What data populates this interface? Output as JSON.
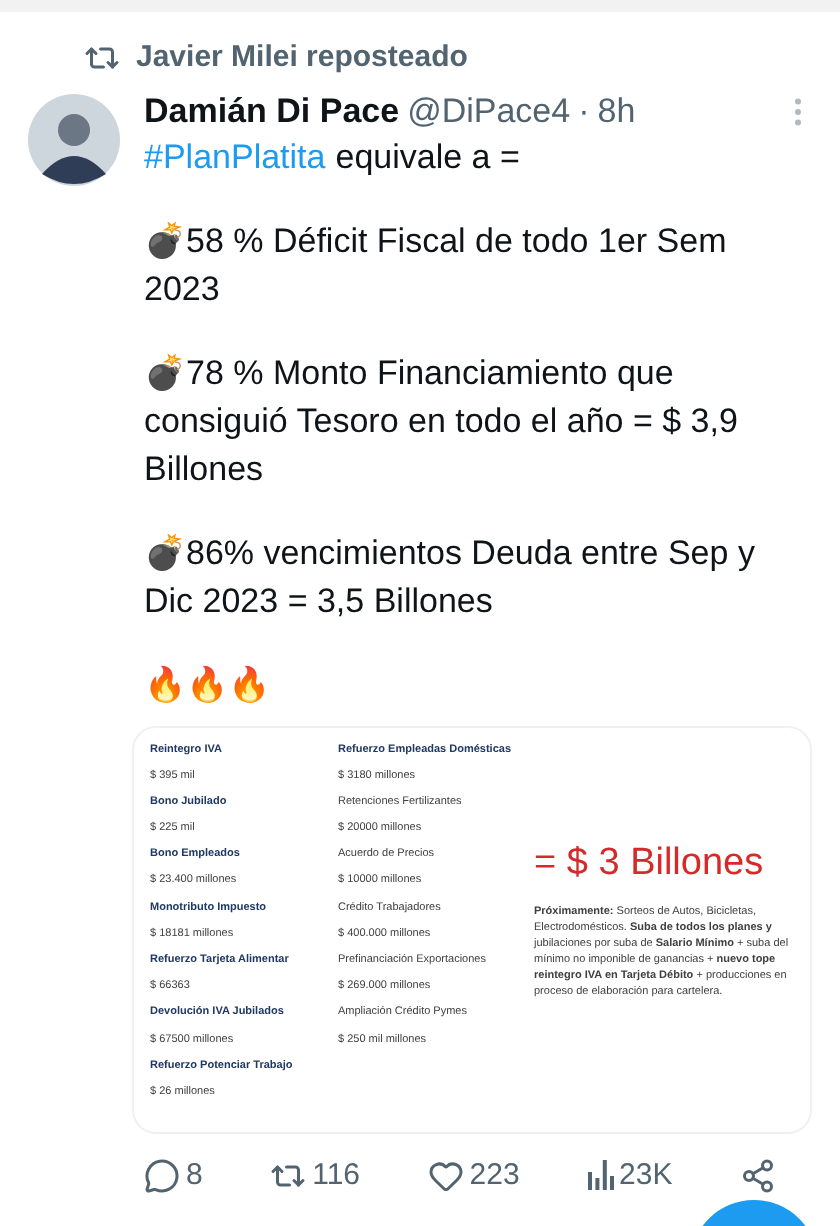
{
  "repost": {
    "label": "Javier Milei reposteado"
  },
  "author": {
    "name": "Damián Di Pace",
    "handle": "@DiPace4",
    "separator": "·",
    "time": "8h"
  },
  "tweet": {
    "hashtag": "#PlanPlatita",
    "intro": "equivale a =",
    "paragraphs": [
      "💣58 % Déficit Fiscal de todo 1er Sem 2023",
      "💣78 % Monto Financiamiento que consiguió Tesoro en todo el año = $ 3,9 Billones",
      "💣86% vencimientos Deuda entre Sep y Dic 2023 = 3,5 Billones",
      "🔥🔥🔥"
    ]
  },
  "document": {
    "columns": [
      [
        {
          "text": "Reintegro IVA",
          "bold": true
        },
        {
          "text": "$ 395 mil",
          "bold": false
        },
        {
          "text": "Bono Jubilado",
          "bold": true
        },
        {
          "text": "$ 225 mil",
          "bold": false
        },
        {
          "text": "Bono Empleados",
          "bold": true
        },
        {
          "text": "$ 23.400 millones",
          "bold": false
        },
        {
          "text": "Monotributo Impuesto",
          "bold": true
        },
        {
          "text": "$ 18181 millones",
          "bold": false
        },
        {
          "text": "Refuerzo Tarjeta Alimentar",
          "bold": true
        },
        {
          "text": "$ 66363",
          "bold": false
        },
        {
          "text": "Devolución IVA Jubilados",
          "bold": true
        },
        {
          "text": "$ 67500 millones",
          "bold": false
        },
        {
          "text": "Refuerzo Potenciar Trabajo",
          "bold": true
        },
        {
          "text": "$ 26 millones",
          "bold": false
        }
      ],
      [
        {
          "text": "Refuerzo Empleadas Domésticas",
          "bold": true
        },
        {
          "text": "$ 3180 millones",
          "bold": false
        },
        {
          "text": "Retenciones Fertilizantes",
          "bold": false
        },
        {
          "text": "$ 20000 millones",
          "bold": false
        },
        {
          "text": "Acuerdo de Precios",
          "bold": false
        },
        {
          "text": "$ 10000 millones",
          "bold": false
        },
        {
          "text": "Crédito Trabajadores",
          "bold": false
        },
        {
          "text": "$ 400.000 millones",
          "bold": false
        },
        {
          "text": "Prefinanciación Exportaciones",
          "bold": false
        },
        {
          "text": "$ 269.000 millones",
          "bold": false
        },
        {
          "text": "Ampliación Crédito Pymes",
          "bold": false
        },
        {
          "text": "$ 250 mil millones",
          "bold": false
        }
      ]
    ],
    "total": "= $ 3 Billones",
    "note": "**Próximamente:** Sorteos de Autos, Bicicletas, Electrodomésticos. **Suba de todos los planes y** jubilaciones por suba de **Salario Mínimo** + suba del mínimo no imponible de ganancias + **nuevo tope reintegro IVA en Tarjeta Débito** + producciones en proceso de elaboración para cartelera."
  },
  "actions": [
    {
      "kind": "reply",
      "count": "8"
    },
    {
      "kind": "repost",
      "count": "116"
    },
    {
      "kind": "like",
      "count": "223"
    },
    {
      "kind": "views",
      "count": "23K"
    },
    {
      "kind": "share"
    }
  ]
}
